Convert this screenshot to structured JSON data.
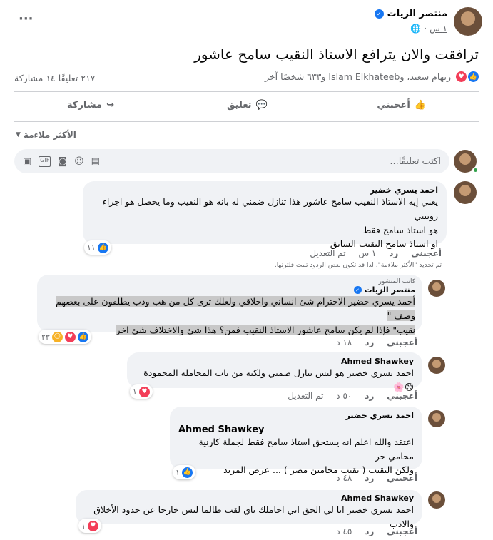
{
  "post": {
    "author": "منتصر الزيات",
    "time": "١ س",
    "text": "ترافقت والان يترافع الاستاذ النقيب سامح عاشور",
    "reactors": "ريهام سعيد، وIslam Elkhateeb و٦٣٣ شخصًا آخر",
    "stats": "٢١٧ تعليقًا ١٤ مشاركة",
    "more": "···"
  },
  "actions": {
    "like": "أعجبني",
    "comment": "تعليق",
    "share": "مشاركة"
  },
  "filter": "الأكثر ملاءمة",
  "composer": {
    "placeholder": "اكتب تعليقًا..."
  },
  "comments": [
    {
      "name": "احمد يسري خضير",
      "lines": [
        "يعني إيه الاستاذ النقيب سامح عاشور هذا تنازل ضمني له بانه هو النقيب وما يحصل هو اجراء روتيني",
        "هو استاذ سامح فقط",
        "او استاذ سامح النقيب السابق"
      ],
      "like": "أعجبني",
      "reply": "رد",
      "time": "١ س",
      "edited": "تم التعديل",
      "reacts": "١١"
    },
    {
      "notice": "تم تحديد \"الأكثر ملاءمة\"، لذا قد تكون بعض الردود تمت فلترتها."
    },
    {
      "badge": "كاتب المنشور",
      "name": "منتصر الزيات",
      "lines": [
        "أحمد يسري خضير الاحترام شئ انساني واخلاقي ولعلك ترى كل من هب ودب يطلقون على بعضهم وصف \"",
        "نقيب\" فإذا لم يكن سامح عاشور الاستاذ النقيب فمن؟ هذا شئ والاختلاف شئ اخر"
      ],
      "like": "أعجبني",
      "reply": "رد",
      "time": "١٨ د",
      "reacts": "٢٣"
    },
    {
      "name": "Ahmed Shawkey",
      "lines": [
        "احمد يسري خضير هو ليس تنازل ضمني ولكنه من باب المجامله المحمودة😊🌸"
      ],
      "like": "أعجبني",
      "reply": "رد",
      "time": "٥٠ د",
      "edited": "تم التعديل",
      "reacts": "١"
    },
    {
      "name": "احمد يسري خضير",
      "mention": "Ahmed Shawkey",
      "lines": [
        "اعتقد والله اعلم انه يستحق استاذ سامح فقط لجملة كارنية محامي حر",
        "ولكن النقيب ( نقيب محامين مصر ) ... عرض المزيد"
      ],
      "like": "أعجبني",
      "reply": "رد",
      "time": "٤٨ د",
      "reacts": "١"
    },
    {
      "name": "Ahmed Shawkey",
      "lines": [
        "احمد يسري خضير انا لي الحق اني اجاملك باي لقب طالما ليس خارجا عن حدود الأخلاق والادب"
      ],
      "like": "أعجبني",
      "reply": "رد",
      "time": "٤٥ د",
      "reacts": "١"
    }
  ],
  "colors": {
    "blue": "#1877f2",
    "love": "#f33e58",
    "care": "#f7b125",
    "gray": "#65676b"
  },
  "icons": [
    "more-icon",
    "verified-icon",
    "globe-icon",
    "like-icon",
    "love-icon",
    "care-icon",
    "thumb-icon",
    "comment-icon",
    "share-icon",
    "chevron-down-icon",
    "sticker-icon",
    "gif-icon",
    "camera-icon",
    "emoji-icon",
    "avatar-icon"
  ]
}
